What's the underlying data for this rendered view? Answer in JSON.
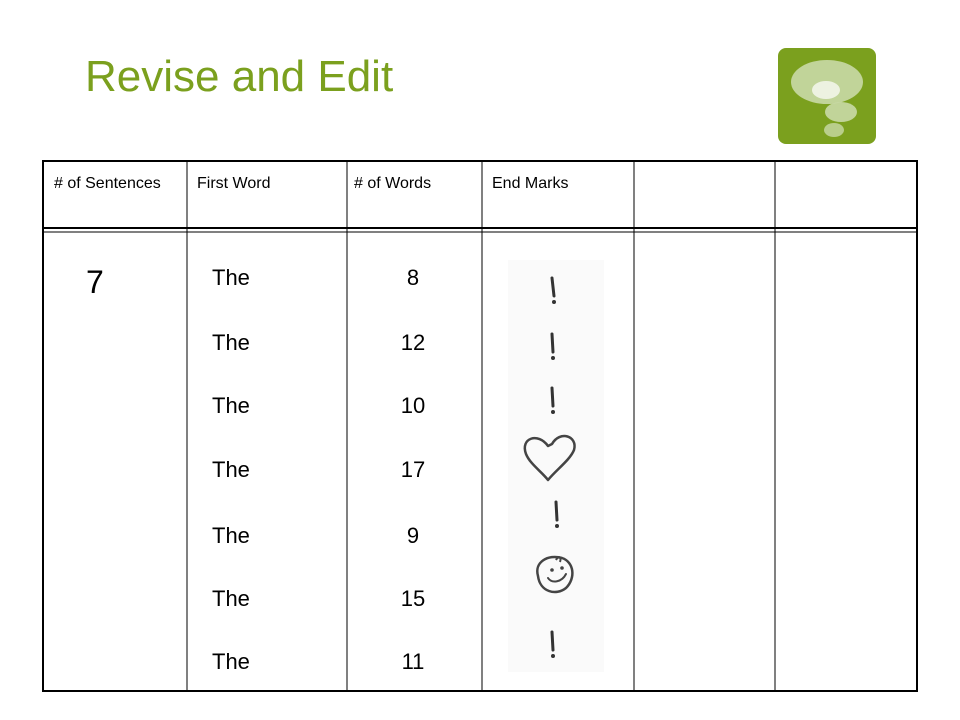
{
  "slide": {
    "title": "Revise and Edit",
    "accent_color": "#7ba01e",
    "logo_icon": "question-bubble-icon"
  },
  "table": {
    "headers": {
      "sentences": "# of Sentences",
      "first_word": "First Word",
      "words": "# of Words",
      "end_marks": "End Marks",
      "extra1": "",
      "extra2": ""
    },
    "sentence_count": "7",
    "first_words": [
      "The",
      "The",
      "The",
      "The",
      "The",
      "The",
      "The"
    ],
    "word_counts": [
      "8",
      "12",
      "10",
      "17",
      "9",
      "15",
      "11"
    ],
    "end_marks": [
      "exclamation-mark-icon",
      "exclamation-mark-icon",
      "exclamation-mark-icon",
      "heart-icon",
      "exclamation-mark-icon",
      "smiley-face-icon",
      "exclamation-mark-icon"
    ]
  }
}
